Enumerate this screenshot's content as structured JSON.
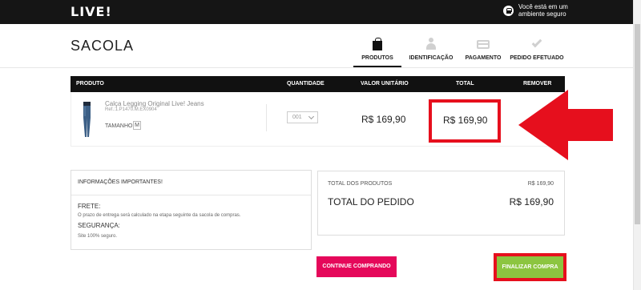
{
  "header": {
    "logo": "LIVE!",
    "secure_text": "Você está em um ambiente seguro"
  },
  "page": {
    "title": "SACOLA"
  },
  "steps": [
    {
      "label": "PRODUTOS",
      "icon": "shopping-bag-icon",
      "active": true
    },
    {
      "label": "IDENTIFICAÇÃO",
      "icon": "user-icon",
      "active": false
    },
    {
      "label": "PAGAMENTO",
      "icon": "credit-card-icon",
      "active": false
    },
    {
      "label": "PEDIDO EFETUADO",
      "icon": "check-icon",
      "active": false
    }
  ],
  "table": {
    "columns": [
      "PRODUTO",
      "QUANTIDADE",
      "VALOR UNITÁRIO",
      "TOTAL",
      "REMOVER"
    ],
    "rows": [
      {
        "name": "Calça Legging Original Live! Jeans",
        "ref": "Ref.:1.P1470.M.EX0904",
        "size_label": "TAMANHO:",
        "size": "M",
        "quantity": "001",
        "unit_price": "R$ 169,90",
        "total": "R$ 169,90"
      }
    ]
  },
  "info": {
    "title": "INFORMAÇÕES IMPORTANTES!",
    "frete_label": "FRETE:",
    "frete_text": "O prazo de entrega será calculado na etapa seguinte da sacola de compras.",
    "seguranca_label": "SEGURANÇA:",
    "seguranca_text": "Site 100% seguro."
  },
  "summary": {
    "subtotal_label": "TOTAL DOS PRODUTOS",
    "subtotal_value": "R$ 169,90",
    "total_label": "TOTAL DO PEDIDO",
    "total_value": "R$ 169,90"
  },
  "buttons": {
    "continue": "CONTINUE COMPRANDO",
    "finalize": "FINALIZAR COMPRA"
  },
  "colors": {
    "highlight_red": "#e60f1d",
    "continue_pink": "#e5085a",
    "finalize_green": "#8cc540",
    "topbar": "#151515"
  }
}
